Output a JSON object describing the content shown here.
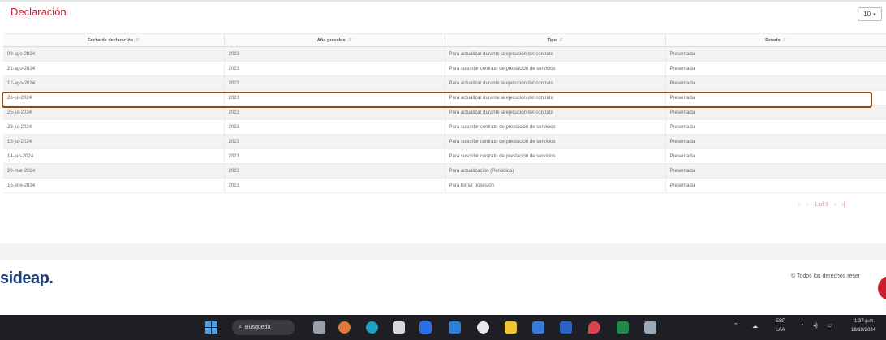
{
  "header": {
    "title": "Declaración",
    "page_size": "10"
  },
  "table": {
    "columns": [
      "Fecha de declaración",
      "Año gravable",
      "Tipo",
      "Estado"
    ],
    "rows": [
      [
        "09-ago-2024",
        "2023",
        "Para actualizar durante la ejecución del contrato",
        "Presentada"
      ],
      [
        "21-ago-2024",
        "2023",
        "Para suscribir contrato de prestación de servicios",
        "Presentada"
      ],
      [
        "12-ago-2024",
        "2023",
        "Para actualizar durante la ejecución del contrato",
        "Presentada"
      ],
      [
        "26-jul-2024",
        "2023",
        "Para actualizar durante la ejecución del contrato",
        "Presentada"
      ],
      [
        "25-jul-2024",
        "2023",
        "Para actualizar durante la ejecución del contrato",
        "Presentada"
      ],
      [
        "23-jul-2024",
        "2023",
        "Para suscribir contrato de prestación de servicios",
        "Presentada"
      ],
      [
        "15-jul-2024",
        "2023",
        "Para suscribir contrato de prestación de servicios",
        "Presentada"
      ],
      [
        "14-jun-2024",
        "2023",
        "Para suscribir contrato de prestación de servicios",
        "Presentada"
      ],
      [
        "20-mar-2024",
        "2023",
        "Para actualización (Periódica)",
        "Presentada"
      ],
      [
        "16-ene-2024",
        "2023",
        "Para tomar posesión",
        "Presentada"
      ]
    ]
  },
  "pager": {
    "first": "|‹",
    "prev": "‹",
    "info": "1 of 3",
    "next": "›",
    "last": "›|"
  },
  "footer": {
    "logo": "sideap.",
    "copyright": "© Todos los derechos reser"
  },
  "taskbar": {
    "search": "Búsqueda",
    "lang": "ESP",
    "region": "LAA",
    "time": "1:37 p.m.",
    "date": "18/10/2024"
  },
  "colors": {
    "accent": "#c2203b",
    "highlight": "#8c4a15",
    "taskbar": "#1e1f24"
  }
}
